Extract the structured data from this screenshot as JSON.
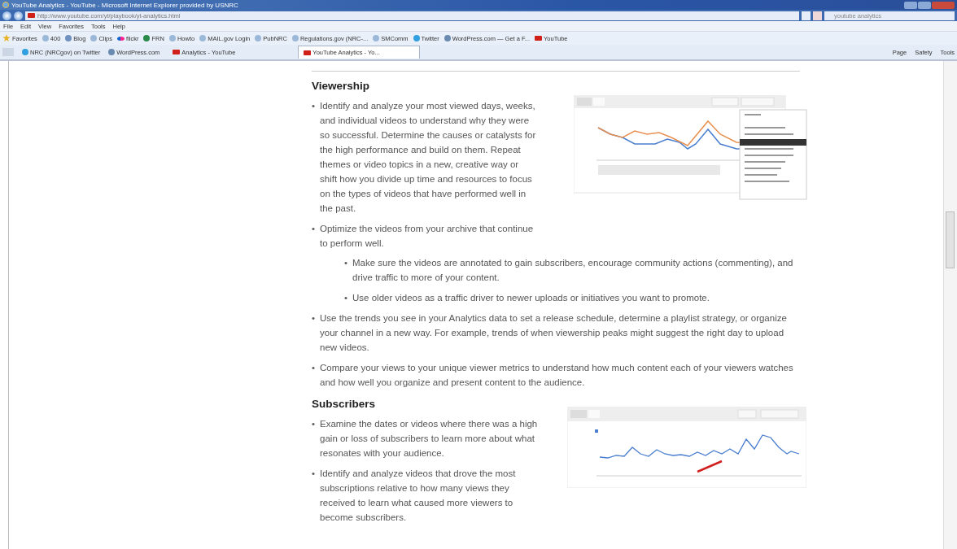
{
  "window": {
    "title": "YouTube Analytics - YouTube - Microsoft Internet Explorer provided by USNRC"
  },
  "address_bar": {
    "url": "http://www.youtube.com/yt/playbook/yt-analytics.html"
  },
  "search": {
    "value": "youtube analytics"
  },
  "menu": [
    "File",
    "Edit",
    "View",
    "Favorites",
    "Tools",
    "Help"
  ],
  "favorites_bar": {
    "label": "Favorites",
    "items": [
      {
        "label": "400",
        "kind": "page"
      },
      {
        "label": "Blog",
        "kind": "blog"
      },
      {
        "label": "Clips",
        "kind": "page"
      },
      {
        "label": "flickr",
        "kind": "flickr"
      },
      {
        "label": "FRN",
        "kind": "globe"
      },
      {
        "label": "Howto",
        "kind": "page"
      },
      {
        "label": "MAIL.gov Login",
        "kind": "page"
      },
      {
        "label": "PubNRC",
        "kind": "page"
      },
      {
        "label": "Regulations.gov (NRC-...",
        "kind": "page"
      },
      {
        "label": "SMComm",
        "kind": "page"
      },
      {
        "label": "Twitter",
        "kind": "bird"
      },
      {
        "label": "WordPress.com — Get a F...",
        "kind": "wordpress"
      },
      {
        "label": "YouTube",
        "kind": "youtube"
      }
    ]
  },
  "quick_tabs": [
    {
      "label": "NRC (NRCgov) on Twitter",
      "kind": "bird"
    },
    {
      "label": "WordPress.com",
      "kind": "wordpress"
    }
  ],
  "tabs": [
    {
      "label": "Analytics - YouTube",
      "selected": false
    },
    {
      "label": "YouTube Analytics - Yo...",
      "selected": true
    }
  ],
  "command_bar": [
    "Page",
    "Safety",
    "Tools"
  ],
  "sections": [
    {
      "heading": "Viewership",
      "items": [
        {
          "marker": "•",
          "text": "Identify and analyze your most viewed days, weeks, and individual videos to understand why they were so successful. Determine the causes or catalysts for the high performance and build on them. Repeat themes or video topics in a new, creative way or shift how you divide up time and resources to focus on the types of videos that have performed well in the past."
        },
        {
          "marker": "•",
          "text": "Optimize the videos from your archive that continue to perform well.",
          "children": [
            {
              "marker": "•",
              "text": "Make sure the videos are annotated to gain subscribers, encourage community actions (commenting), and drive traffic to more of your content."
            },
            {
              "marker": "•",
              "text": "Use older videos as a traffic driver to newer uploads or initiatives you want to promote."
            }
          ]
        },
        {
          "marker": "•",
          "text": "Use the trends you see in your Analytics data to set a release schedule, determine a playlist strategy, or organize your channel in a new way. For example, trends of when viewership peaks might suggest the right day to upload new videos."
        },
        {
          "marker": "•",
          "text": "Compare your views to your unique viewer metrics to understand how much content each of your viewers watches and how well you organize and present content to the audience."
        }
      ]
    },
    {
      "heading": "Subscribers",
      "items": [
        {
          "marker": "•",
          "text": "Examine the dates or videos where there was a high gain or loss of subscribers to learn more about what resonates with your audience."
        },
        {
          "marker": "•",
          "text": "Identify and analyze videos that drove the most subscriptions relative to how many views they received to learn what caused more viewers to become subscribers."
        }
      ]
    }
  ]
}
